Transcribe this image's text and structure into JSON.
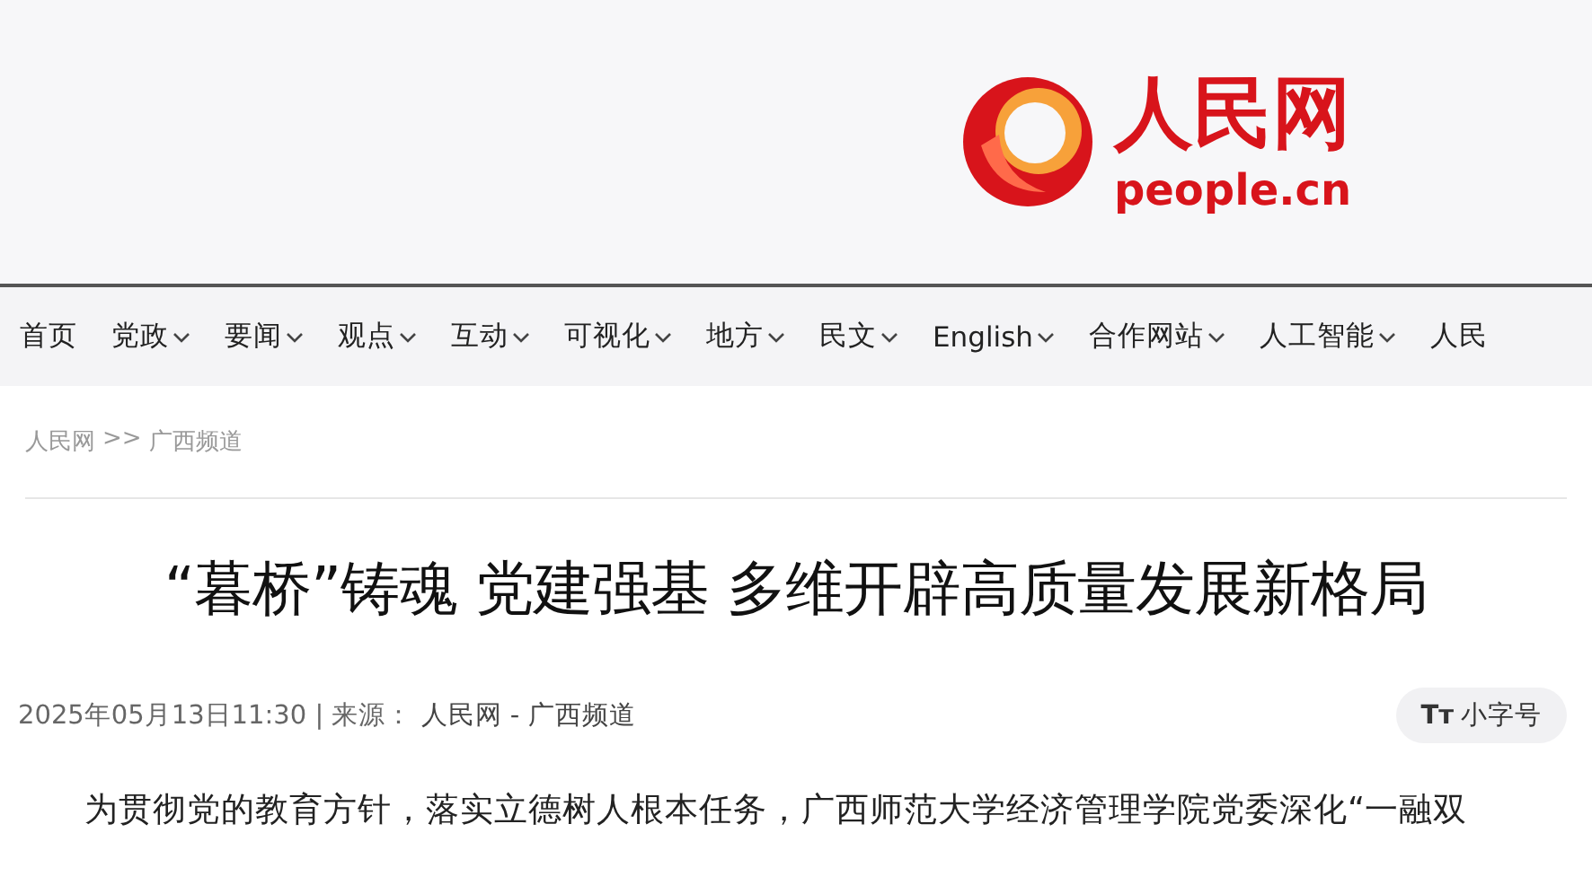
{
  "logo": {
    "name": "人民网",
    "domain": "people.cn"
  },
  "nav": [
    {
      "label": "首页",
      "dropdown": false
    },
    {
      "label": "党政",
      "dropdown": true
    },
    {
      "label": "要闻",
      "dropdown": true
    },
    {
      "label": "观点",
      "dropdown": true
    },
    {
      "label": "互动",
      "dropdown": true
    },
    {
      "label": "可视化",
      "dropdown": true
    },
    {
      "label": "地方",
      "dropdown": true
    },
    {
      "label": "民文",
      "dropdown": true
    },
    {
      "label": "English",
      "dropdown": true
    },
    {
      "label": "合作网站",
      "dropdown": true
    },
    {
      "label": "人工智能",
      "dropdown": true
    },
    {
      "label": "人民",
      "dropdown": false
    }
  ],
  "breadcrumb": [
    "人民网",
    ">>",
    "广西频道"
  ],
  "article": {
    "title": "“暮桥”铸魂 党建强基 多维开辟高质量发展新格局",
    "date": "2025年05月13日11:30",
    "divider": "|",
    "source_label": "来源：",
    "source": "人民网 - 广西频道",
    "font_button": {
      "icon": "Tт",
      "label": "小字号"
    },
    "paragraph": "为贯彻党的教育方针，落实立德树人根本任务，广西师范大学经济管理学院党委深化“一融双"
  }
}
